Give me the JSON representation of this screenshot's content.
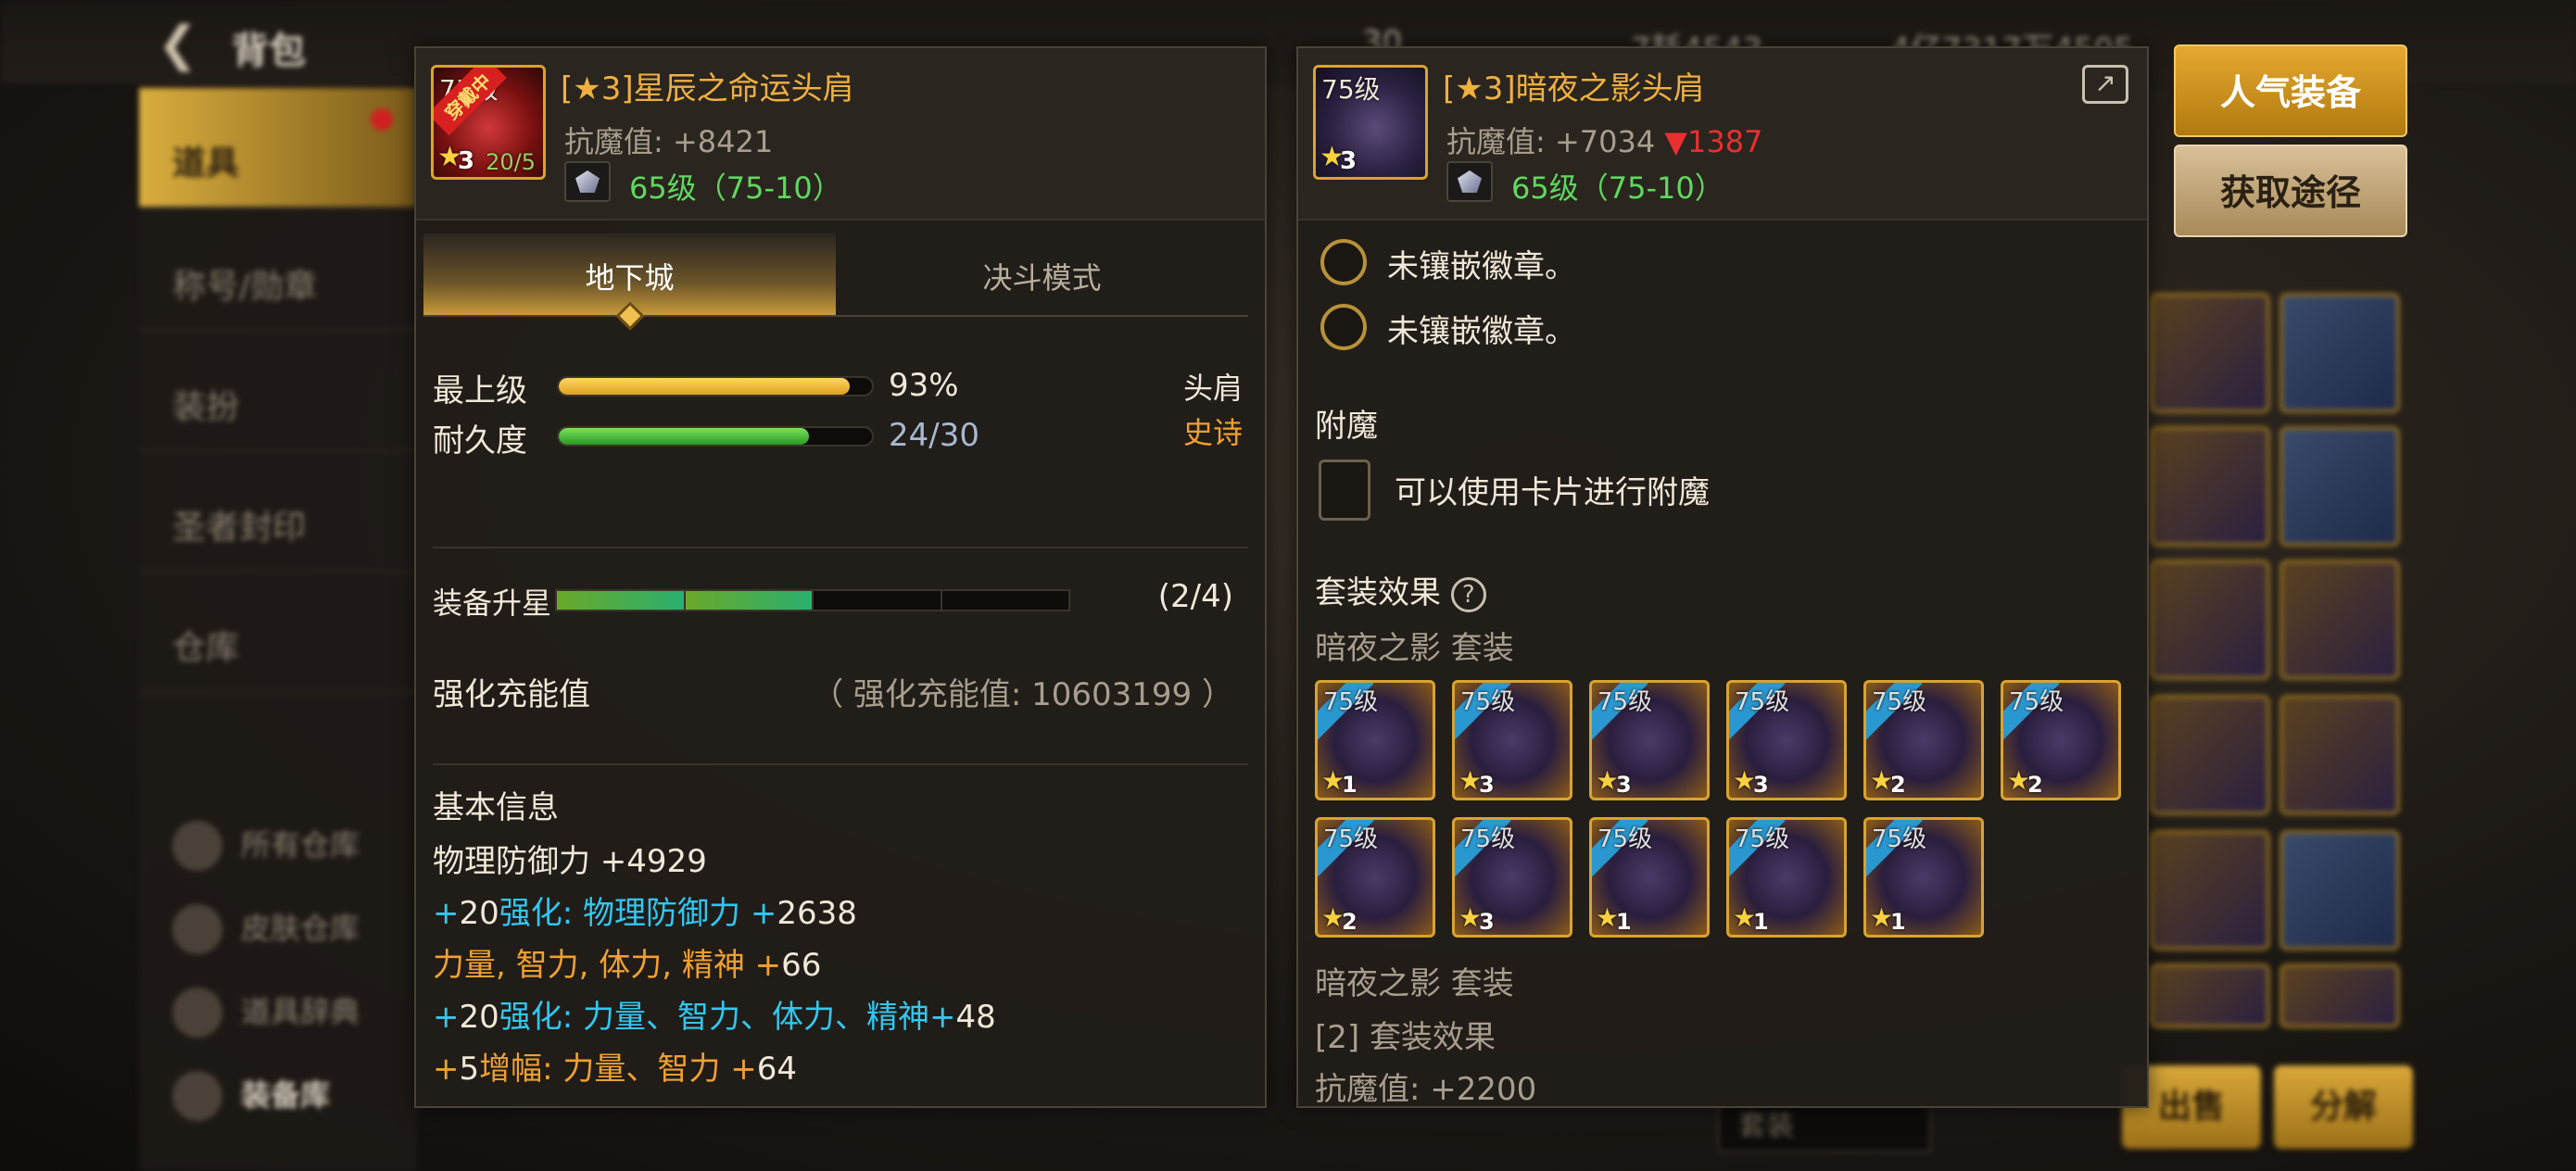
{
  "background": {
    "title": "背包",
    "currency": [
      "30",
      "7耗4543",
      "4亿7317万4505"
    ],
    "sidebar": [
      {
        "label": "道具",
        "active": true
      },
      {
        "label": "称号/勋章",
        "active": false
      },
      {
        "label": "装扮",
        "active": false
      },
      {
        "label": "圣者封印",
        "active": false
      },
      {
        "label": "仓库",
        "active": false
      }
    ],
    "stores": [
      "所有仓库",
      "皮肤仓库",
      "道具辞典",
      "装备库"
    ],
    "bottom_buttons": [
      "出售",
      "分解"
    ],
    "dropdown": "套装"
  },
  "left_item": {
    "icon_level": "75级",
    "wearing_badge": "穿戴中",
    "star": "3",
    "count": "20/5",
    "name": "[★3]星辰之命运头肩",
    "resist": "抗魔值: +8421",
    "level_range": "65级（75-10）",
    "tabs": [
      "地下城",
      "决斗模式"
    ],
    "stats": [
      {
        "label": "最上级",
        "value": "93%",
        "percent": 93,
        "color": "orange"
      },
      {
        "label": "耐久度",
        "value": "24/30",
        "percent": 80,
        "color": "green"
      }
    ],
    "slot": "头肩",
    "rarity": "史诗",
    "upgrade": {
      "label": "装备升星",
      "count": "(2/4)",
      "filled": 2,
      "total": 4
    },
    "charge": {
      "label": "强化充能值",
      "value": "（ 强化充能值: 10603199 ）"
    },
    "basic_info": {
      "title": "基本信息",
      "lines": [
        [
          {
            "t": "物理防御力 +",
            "c": "white"
          },
          {
            "t": "4929",
            "c": "white"
          }
        ],
        [
          {
            "t": "+",
            "c": "cyan"
          },
          {
            "t": "20",
            "c": "white"
          },
          {
            "t": "强化: 物理防御力 +",
            "c": "cyan"
          },
          {
            "t": "2638",
            "c": "white"
          }
        ],
        [
          {
            "t": "力量, 智力, 体力, 精神 +",
            "c": "orange"
          },
          {
            "t": "66",
            "c": "white"
          }
        ],
        [
          {
            "t": "+",
            "c": "cyan"
          },
          {
            "t": "20",
            "c": "white"
          },
          {
            "t": "强化: 力量、智力、体力、精神+",
            "c": "cyan"
          },
          {
            "t": "48",
            "c": "white"
          }
        ],
        [
          {
            "t": " +",
            "c": "orange"
          },
          {
            "t": "5",
            "c": "white"
          },
          {
            "t": "增幅: 力量、智力 +",
            "c": "orange"
          },
          {
            "t": "64",
            "c": "white"
          }
        ]
      ]
    }
  },
  "right_item": {
    "icon_level": "75级",
    "star": "3",
    "name": "[★3]暗夜之影头肩",
    "resist": "抗魔值: +7034",
    "resist_diff": "▼1387",
    "level_range": "65级（75-10）",
    "emblems": [
      "未镶嵌徽章。",
      "未镶嵌徽章。"
    ],
    "enchant_title": "附魔",
    "enchant_text": "可以使用卡片进行附魔",
    "set_title": "套装效果",
    "set_name": "暗夜之影  套装",
    "set_items": [
      {
        "lvl": "75级",
        "star": "1"
      },
      {
        "lvl": "75级",
        "star": "3"
      },
      {
        "lvl": "75级",
        "star": "3"
      },
      {
        "lvl": "75级",
        "star": "3"
      },
      {
        "lvl": "75级",
        "star": "2"
      },
      {
        "lvl": "75级",
        "star": "2"
      },
      {
        "lvl": "75级",
        "star": "2"
      },
      {
        "lvl": "75级",
        "star": "3"
      },
      {
        "lvl": "75级",
        "star": "1"
      },
      {
        "lvl": "75级",
        "star": "1"
      },
      {
        "lvl": "75级",
        "star": "1"
      }
    ],
    "set_footer": [
      "暗夜之影  套装",
      "[2] 套装效果",
      "抗魔值: +2200"
    ]
  },
  "actions": {
    "popular": "人气装备",
    "source": "获取途径"
  }
}
